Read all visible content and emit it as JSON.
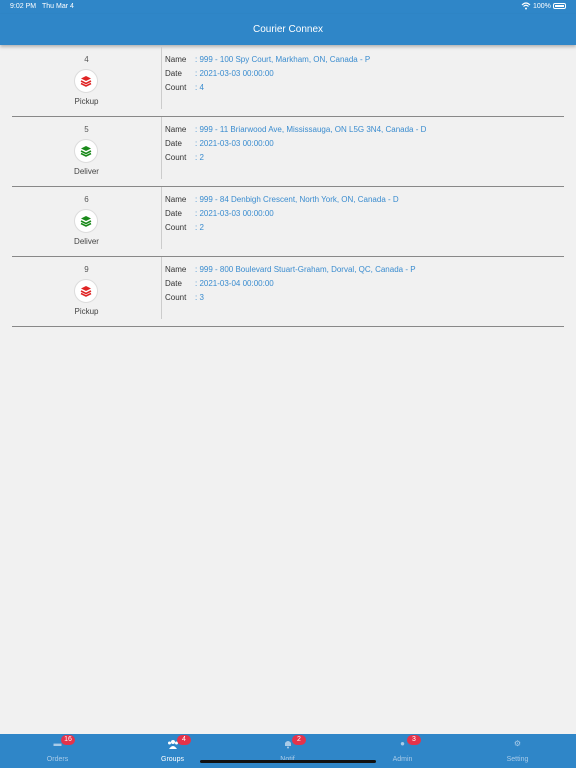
{
  "status_bar": {
    "time": "9:02 PM",
    "date": "Thu Mar 4",
    "battery": "100%"
  },
  "header": {
    "title": "Courier Connex"
  },
  "labels": {
    "name": "Name",
    "date": "Date",
    "count": "Count"
  },
  "colors": {
    "accent": "#2f86c8",
    "link": "#3a8ccf",
    "pickup": "#e02424",
    "deliver": "#1a8a1a",
    "badge": "#e5334b"
  },
  "orders": [
    {
      "number": "4",
      "type": "Pickup",
      "icon": "layers-icon-red",
      "name": ": 999 - 100 Spy Court, Markham, ON, Canada - P",
      "date": ": 2021-03-03 00:00:00",
      "count": ": 4"
    },
    {
      "number": "5",
      "type": "Deliver",
      "icon": "layers-icon-green",
      "name": ": 999 - 11 Briarwood Ave, Mississauga, ON L5G 3N4, Canada - D",
      "date": ": 2021-03-03 00:00:00",
      "count": ": 2"
    },
    {
      "number": "6",
      "type": "Deliver",
      "icon": "layers-icon-green",
      "name": ": 999 - 84 Denbigh Crescent, North York, ON, Canada - D",
      "date": ": 2021-03-03 00:00:00",
      "count": ": 2"
    },
    {
      "number": "9",
      "type": "Pickup",
      "icon": "layers-icon-red",
      "name": ": 999 - 800 Boulevard Stuart-Graham, Dorval, QC, Canada - P",
      "date": ": 2021-03-04 00:00:00",
      "count": ": 3"
    }
  ],
  "tabs": [
    {
      "label": "Orders",
      "badge": "16",
      "icon": "orders-icon",
      "active": false
    },
    {
      "label": "Groups",
      "badge": "4",
      "icon": "groups-icon",
      "active": true
    },
    {
      "label": "Notif",
      "badge": "2",
      "icon": "bell-icon",
      "active": false
    },
    {
      "label": "Admin",
      "badge": "3",
      "icon": "admin-icon",
      "active": false
    },
    {
      "label": "Setting",
      "badge": "",
      "icon": "gear-icon",
      "active": false
    }
  ]
}
